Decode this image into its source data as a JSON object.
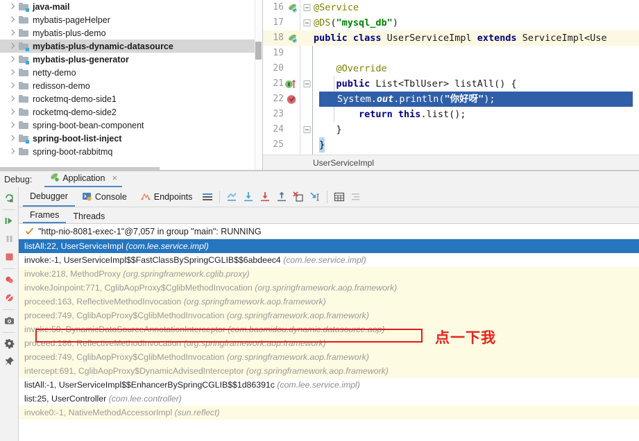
{
  "tree": {
    "items": [
      {
        "label": "java-mail",
        "bold": true,
        "module": true,
        "selected": false
      },
      {
        "label": "mybatis-pageHelper",
        "bold": false,
        "module": false,
        "selected": false
      },
      {
        "label": "mybatis-plus-demo",
        "bold": false,
        "module": false,
        "selected": false
      },
      {
        "label": "mybatis-plus-dynamic-datasource",
        "bold": true,
        "module": true,
        "selected": true
      },
      {
        "label": "mybatis-plus-generator",
        "bold": true,
        "module": true,
        "selected": false
      },
      {
        "label": "netty-demo",
        "bold": false,
        "module": false,
        "selected": false
      },
      {
        "label": "redisson-demo",
        "bold": false,
        "module": false,
        "selected": false
      },
      {
        "label": "rocketmq-demo-side1",
        "bold": false,
        "module": false,
        "selected": false
      },
      {
        "label": "rocketmq-demo-side2",
        "bold": false,
        "module": false,
        "selected": false
      },
      {
        "label": "spring-boot-bean-component",
        "bold": false,
        "module": false,
        "selected": false
      },
      {
        "label": "spring-boot-list-inject",
        "bold": true,
        "module": true,
        "selected": false
      },
      {
        "label": "spring-boot-rabbitmq",
        "bold": false,
        "module": false,
        "selected": false
      }
    ]
  },
  "editor": {
    "breadcrumb": "UserServiceImpl",
    "lines": [
      {
        "no": "16",
        "gutter": "spring-bean-icon",
        "fold": "fold-collapse",
        "highlight": false,
        "tokens": [
          {
            "t": "@Service",
            "c": "ann"
          }
        ]
      },
      {
        "no": "17",
        "gutter": "",
        "fold": "fold-collapse",
        "highlight": false,
        "tokens": [
          {
            "t": "@DS",
            "c": "ann"
          },
          {
            "t": "(",
            "c": "pln"
          },
          {
            "t": "\"mysql_db\"",
            "c": "str"
          },
          {
            "t": ")",
            "c": "pln"
          }
        ]
      },
      {
        "no": "18",
        "gutter": "spring-bean-icon",
        "fold": "",
        "highlight": true,
        "tokens": [
          {
            "t": "public class ",
            "c": "kw"
          },
          {
            "t": "UserServiceImpl ",
            "c": "pln"
          },
          {
            "t": "extends ",
            "c": "kw"
          },
          {
            "t": "ServiceImpl<Use",
            "c": "pln"
          }
        ]
      },
      {
        "no": "19",
        "gutter": "",
        "fold": "",
        "highlight": false,
        "tokens": []
      },
      {
        "no": "20",
        "gutter": "",
        "fold": "",
        "highlight": false,
        "tokens": [
          {
            "t": "    @Override",
            "c": "ann"
          }
        ]
      },
      {
        "no": "21",
        "gutter": "override-method-icon",
        "fold": "fold-collapse",
        "highlight": false,
        "tokens": [
          {
            "t": "    public ",
            "c": "kw"
          },
          {
            "t": "List<TblUser> listAll() {",
            "c": "pln"
          }
        ]
      },
      {
        "no": "22",
        "gutter": "breakpoint-verified-icon",
        "fold": "",
        "highlight": false,
        "tokens": []
      },
      {
        "no": "23",
        "gutter": "",
        "fold": "",
        "highlight": false,
        "tokens": [
          {
            "t": "        ",
            "c": "pln"
          },
          {
            "t": "return this",
            "c": "kw"
          },
          {
            "t": ".list();",
            "c": "pln"
          }
        ]
      },
      {
        "no": "24",
        "gutter": "",
        "fold": "fold-collapse",
        "highlight": false,
        "tokens": [
          {
            "t": "    }",
            "c": "pln"
          }
        ]
      },
      {
        "no": "25",
        "gutter": "",
        "fold": "",
        "highlight": false,
        "tokens": []
      }
    ],
    "selected_line": {
      "prefix": "System.",
      "field": "out",
      "mid": ".println(",
      "string": "\"你好呀\"",
      "suffix": ");"
    },
    "last_brace": "}"
  },
  "debug": {
    "label": "Debug:",
    "run_tab": {
      "name": "Application",
      "icon": "spring-boot-run-icon",
      "close": "×"
    },
    "tabs": [
      {
        "label": "Debugger",
        "icon": "",
        "active": true
      },
      {
        "label": "Console",
        "icon": "console-icon",
        "active": false
      },
      {
        "label": "Endpoints",
        "icon": "endpoints-icon",
        "active": false
      }
    ],
    "toolbar_icons": [
      "layout-settings-icon",
      "show-execution-point-icon",
      "step-over-icon",
      "step-into-icon",
      "step-out-icon",
      "force-step-into-icon",
      "run-to-cursor-icon",
      "evaluate-expression-icon",
      "restore-layout-icon"
    ],
    "side_actions": [
      "rerun-icon",
      "resume-program-icon",
      "pause-program-icon",
      "stop-icon",
      "mute-breakpoints-icon",
      "view-breakpoints-icon",
      "camera-icon",
      "settings-gear-icon",
      "pin-tab-icon"
    ],
    "frames_tabs": [
      {
        "label": "Frames",
        "active": true
      },
      {
        "label": "Threads",
        "active": false
      }
    ],
    "thread": "\"http-nio-8081-exec-1\"@7,057 in group \"main\": RUNNING",
    "frames": [
      {
        "method": "listAll:22, UserServiceImpl",
        "pkg": "(com.lee.service.impl)",
        "kind": "selected"
      },
      {
        "method": "invoke:-1, UserServiceImpl$$FastClassBySpringCGLIB$$6abdeec4",
        "pkg": "(com.lee.service.impl)",
        "kind": "proj"
      },
      {
        "method": "invoke:218, MethodProxy",
        "pkg": "(org.springframework.cglib.proxy)",
        "kind": "lib"
      },
      {
        "method": "invokeJoinpoint:771, CglibAopProxy$CglibMethodInvocation",
        "pkg": "(org.springframework.aop.framework)",
        "kind": "lib"
      },
      {
        "method": "proceed:163, ReflectiveMethodInvocation",
        "pkg": "(org.springframework.aop.framework)",
        "kind": "lib"
      },
      {
        "method": "proceed:749, CglibAopProxy$CglibMethodInvocation",
        "pkg": "(org.springframework.aop.framework)",
        "kind": "lib"
      },
      {
        "method": "invoke:50, DynamicDataSourceAnnotationInterceptor",
        "pkg": "(com.baomidou.dynamic.datasource.aop)",
        "kind": "lib"
      },
      {
        "method": "proceed:186, ReflectiveMethodInvocation",
        "pkg": "(org.springframework.aop.framework)",
        "kind": "lib"
      },
      {
        "method": "proceed:749, CglibAopProxy$CglibMethodInvocation",
        "pkg": "(org.springframework.aop.framework)",
        "kind": "lib"
      },
      {
        "method": "intercept:691, CglibAopProxy$DynamicAdvisedInterceptor",
        "pkg": "(org.springframework.aop.framework)",
        "kind": "lib"
      },
      {
        "method": "listAll:-1, UserServiceImpl$$EnhancerBySpringCGLIB$$1d86391c",
        "pkg": "(com.lee.service.impl)",
        "kind": "proj"
      },
      {
        "method": "list:25, UserController",
        "pkg": "(com.lee.controller)",
        "kind": "proj"
      },
      {
        "method": "invoke0:-1, NativeMethodAccessorImpl",
        "pkg": "(sun.reflect)",
        "kind": "lib"
      }
    ]
  },
  "annotation": {
    "text": "点一下我",
    "color": "#e8231c",
    "box_color": "#e01b1b"
  },
  "colors": {
    "selection_blue": "#2675bf",
    "library_row_yellow": "#fdfbe1",
    "tab_underline": "#4a89c8",
    "keyword_navy": "#000080",
    "annotation_olive": "#808000",
    "string_green": "#008000"
  }
}
